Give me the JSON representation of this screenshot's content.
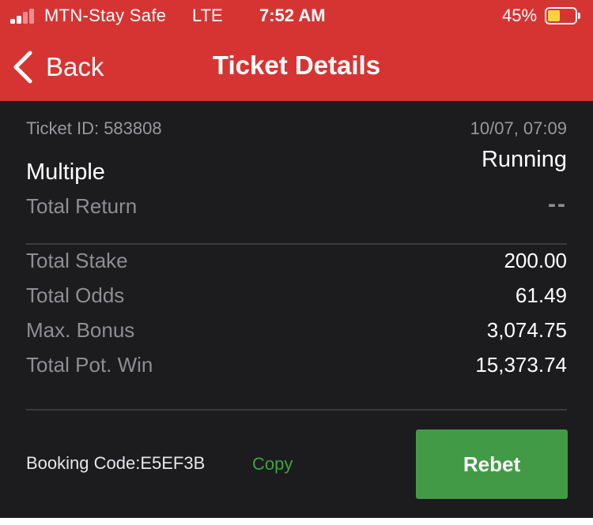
{
  "status_bar": {
    "signal_bars": 4,
    "signal_strength": 2,
    "carrier": "MTN-Stay Safe",
    "network": "LTE",
    "time": "7:52 AM",
    "battery_percent": "45%",
    "battery_level": 0.45,
    "battery_fill_color": "#f8d53c"
  },
  "nav": {
    "back_icon": "chevron-left-icon",
    "back_label": "Back",
    "title": "Ticket Details"
  },
  "ticket": {
    "id_text": "Ticket ID: 583808",
    "datetime": "10/07, 07:09",
    "bet_type": "Multiple",
    "status": "Running",
    "total_return_label": "Total Return",
    "total_return_value": "--"
  },
  "summary": [
    {
      "label": "Total Stake",
      "value": "200.00"
    },
    {
      "label": "Total Odds",
      "value": "61.49"
    },
    {
      "label": "Max. Bonus",
      "value": "3,074.75"
    },
    {
      "label": "Total Pot. Win",
      "value": "15,373.74"
    }
  ],
  "booking": {
    "code_text": "Booking Code:E5EF3B",
    "copy_label": "Copy",
    "rebet_label": "Rebet"
  },
  "colors": {
    "header": "#d63433",
    "content_bg": "#1c1c1e",
    "accent_green": "#429a47",
    "copy_green": "#3da442"
  }
}
